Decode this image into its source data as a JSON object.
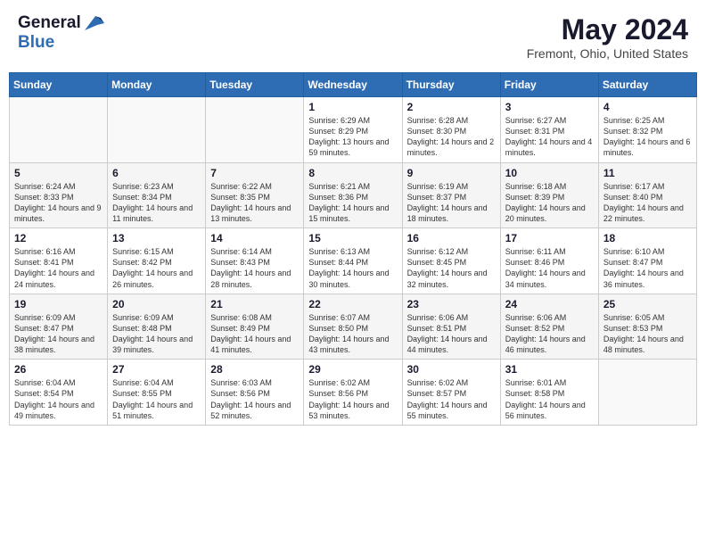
{
  "logo": {
    "general": "General",
    "blue": "Blue"
  },
  "title": "May 2024",
  "location": "Fremont, Ohio, United States",
  "days_of_week": [
    "Sunday",
    "Monday",
    "Tuesday",
    "Wednesday",
    "Thursday",
    "Friday",
    "Saturday"
  ],
  "weeks": [
    [
      {
        "num": "",
        "sunrise": "",
        "sunset": "",
        "daylight": ""
      },
      {
        "num": "",
        "sunrise": "",
        "sunset": "",
        "daylight": ""
      },
      {
        "num": "",
        "sunrise": "",
        "sunset": "",
        "daylight": ""
      },
      {
        "num": "1",
        "sunrise": "Sunrise: 6:29 AM",
        "sunset": "Sunset: 8:29 PM",
        "daylight": "Daylight: 13 hours and 59 minutes."
      },
      {
        "num": "2",
        "sunrise": "Sunrise: 6:28 AM",
        "sunset": "Sunset: 8:30 PM",
        "daylight": "Daylight: 14 hours and 2 minutes."
      },
      {
        "num": "3",
        "sunrise": "Sunrise: 6:27 AM",
        "sunset": "Sunset: 8:31 PM",
        "daylight": "Daylight: 14 hours and 4 minutes."
      },
      {
        "num": "4",
        "sunrise": "Sunrise: 6:25 AM",
        "sunset": "Sunset: 8:32 PM",
        "daylight": "Daylight: 14 hours and 6 minutes."
      }
    ],
    [
      {
        "num": "5",
        "sunrise": "Sunrise: 6:24 AM",
        "sunset": "Sunset: 8:33 PM",
        "daylight": "Daylight: 14 hours and 9 minutes."
      },
      {
        "num": "6",
        "sunrise": "Sunrise: 6:23 AM",
        "sunset": "Sunset: 8:34 PM",
        "daylight": "Daylight: 14 hours and 11 minutes."
      },
      {
        "num": "7",
        "sunrise": "Sunrise: 6:22 AM",
        "sunset": "Sunset: 8:35 PM",
        "daylight": "Daylight: 14 hours and 13 minutes."
      },
      {
        "num": "8",
        "sunrise": "Sunrise: 6:21 AM",
        "sunset": "Sunset: 8:36 PM",
        "daylight": "Daylight: 14 hours and 15 minutes."
      },
      {
        "num": "9",
        "sunrise": "Sunrise: 6:19 AM",
        "sunset": "Sunset: 8:37 PM",
        "daylight": "Daylight: 14 hours and 18 minutes."
      },
      {
        "num": "10",
        "sunrise": "Sunrise: 6:18 AM",
        "sunset": "Sunset: 8:39 PM",
        "daylight": "Daylight: 14 hours and 20 minutes."
      },
      {
        "num": "11",
        "sunrise": "Sunrise: 6:17 AM",
        "sunset": "Sunset: 8:40 PM",
        "daylight": "Daylight: 14 hours and 22 minutes."
      }
    ],
    [
      {
        "num": "12",
        "sunrise": "Sunrise: 6:16 AM",
        "sunset": "Sunset: 8:41 PM",
        "daylight": "Daylight: 14 hours and 24 minutes."
      },
      {
        "num": "13",
        "sunrise": "Sunrise: 6:15 AM",
        "sunset": "Sunset: 8:42 PM",
        "daylight": "Daylight: 14 hours and 26 minutes."
      },
      {
        "num": "14",
        "sunrise": "Sunrise: 6:14 AM",
        "sunset": "Sunset: 8:43 PM",
        "daylight": "Daylight: 14 hours and 28 minutes."
      },
      {
        "num": "15",
        "sunrise": "Sunrise: 6:13 AM",
        "sunset": "Sunset: 8:44 PM",
        "daylight": "Daylight: 14 hours and 30 minutes."
      },
      {
        "num": "16",
        "sunrise": "Sunrise: 6:12 AM",
        "sunset": "Sunset: 8:45 PM",
        "daylight": "Daylight: 14 hours and 32 minutes."
      },
      {
        "num": "17",
        "sunrise": "Sunrise: 6:11 AM",
        "sunset": "Sunset: 8:46 PM",
        "daylight": "Daylight: 14 hours and 34 minutes."
      },
      {
        "num": "18",
        "sunrise": "Sunrise: 6:10 AM",
        "sunset": "Sunset: 8:47 PM",
        "daylight": "Daylight: 14 hours and 36 minutes."
      }
    ],
    [
      {
        "num": "19",
        "sunrise": "Sunrise: 6:09 AM",
        "sunset": "Sunset: 8:47 PM",
        "daylight": "Daylight: 14 hours and 38 minutes."
      },
      {
        "num": "20",
        "sunrise": "Sunrise: 6:09 AM",
        "sunset": "Sunset: 8:48 PM",
        "daylight": "Daylight: 14 hours and 39 minutes."
      },
      {
        "num": "21",
        "sunrise": "Sunrise: 6:08 AM",
        "sunset": "Sunset: 8:49 PM",
        "daylight": "Daylight: 14 hours and 41 minutes."
      },
      {
        "num": "22",
        "sunrise": "Sunrise: 6:07 AM",
        "sunset": "Sunset: 8:50 PM",
        "daylight": "Daylight: 14 hours and 43 minutes."
      },
      {
        "num": "23",
        "sunrise": "Sunrise: 6:06 AM",
        "sunset": "Sunset: 8:51 PM",
        "daylight": "Daylight: 14 hours and 44 minutes."
      },
      {
        "num": "24",
        "sunrise": "Sunrise: 6:06 AM",
        "sunset": "Sunset: 8:52 PM",
        "daylight": "Daylight: 14 hours and 46 minutes."
      },
      {
        "num": "25",
        "sunrise": "Sunrise: 6:05 AM",
        "sunset": "Sunset: 8:53 PM",
        "daylight": "Daylight: 14 hours and 48 minutes."
      }
    ],
    [
      {
        "num": "26",
        "sunrise": "Sunrise: 6:04 AM",
        "sunset": "Sunset: 8:54 PM",
        "daylight": "Daylight: 14 hours and 49 minutes."
      },
      {
        "num": "27",
        "sunrise": "Sunrise: 6:04 AM",
        "sunset": "Sunset: 8:55 PM",
        "daylight": "Daylight: 14 hours and 51 minutes."
      },
      {
        "num": "28",
        "sunrise": "Sunrise: 6:03 AM",
        "sunset": "Sunset: 8:56 PM",
        "daylight": "Daylight: 14 hours and 52 minutes."
      },
      {
        "num": "29",
        "sunrise": "Sunrise: 6:02 AM",
        "sunset": "Sunset: 8:56 PM",
        "daylight": "Daylight: 14 hours and 53 minutes."
      },
      {
        "num": "30",
        "sunrise": "Sunrise: 6:02 AM",
        "sunset": "Sunset: 8:57 PM",
        "daylight": "Daylight: 14 hours and 55 minutes."
      },
      {
        "num": "31",
        "sunrise": "Sunrise: 6:01 AM",
        "sunset": "Sunset: 8:58 PM",
        "daylight": "Daylight: 14 hours and 56 minutes."
      },
      {
        "num": "",
        "sunrise": "",
        "sunset": "",
        "daylight": ""
      }
    ]
  ]
}
